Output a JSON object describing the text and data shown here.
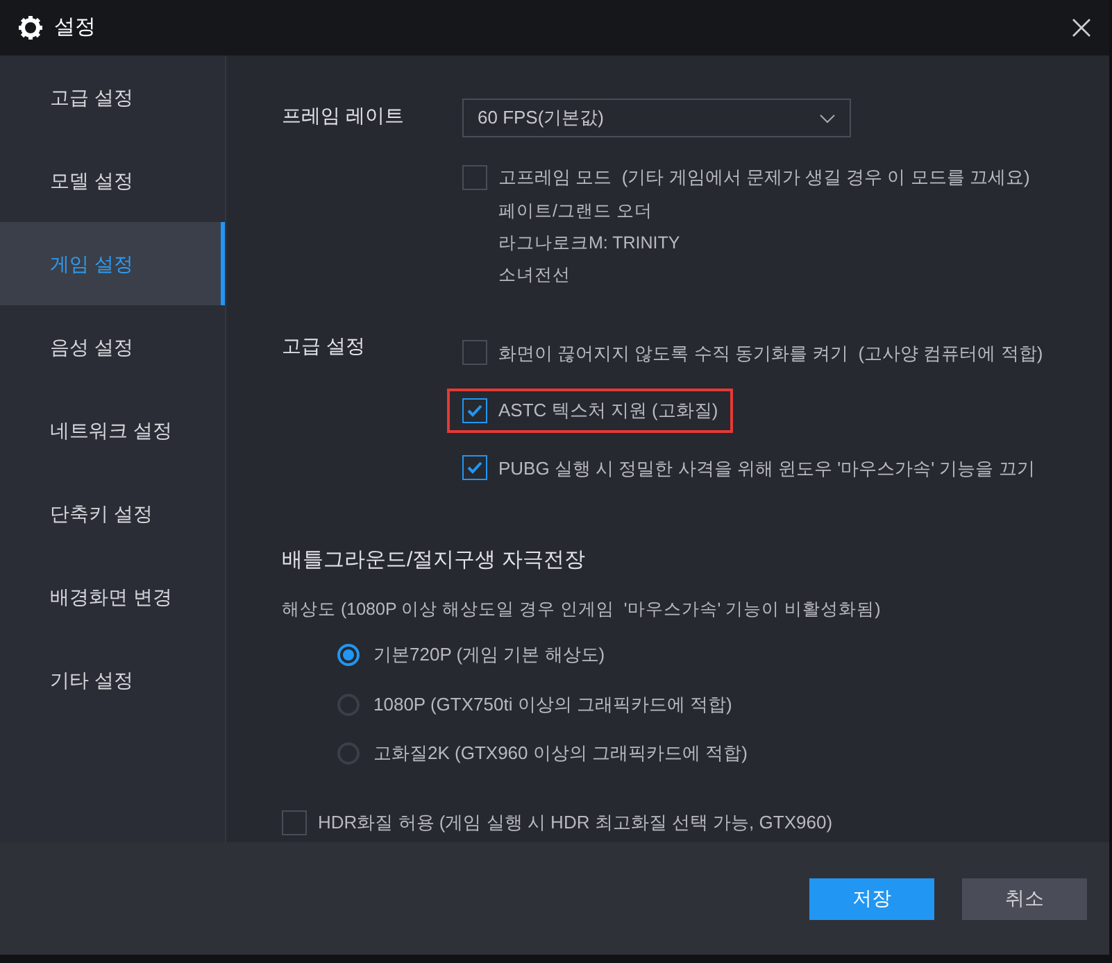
{
  "window": {
    "title": "설정"
  },
  "sidebar": {
    "items": [
      {
        "label": "고급 설정",
        "selected": false
      },
      {
        "label": "모델 설정",
        "selected": false
      },
      {
        "label": "게임 설정",
        "selected": true
      },
      {
        "label": "음성 설정",
        "selected": false
      },
      {
        "label": "네트워크 설정",
        "selected": false
      },
      {
        "label": "단축키 설정",
        "selected": false
      },
      {
        "label": "배경화면 변경",
        "selected": false
      },
      {
        "label": "기타 설정",
        "selected": false
      }
    ]
  },
  "frame_rate": {
    "label": "프레임 레이트",
    "dropdown": "60 FPS(기본값)",
    "high_frame_mode": {
      "label": "고프레임 모드  (기타 게임에서 문제가 생길 경우 이 모드를 끄세요)",
      "checked": false
    },
    "games": [
      "페이트/그랜드 오더",
      "라그나로크M: TRINITY",
      "소녀전선"
    ]
  },
  "advanced": {
    "label": "고급 설정",
    "options": [
      {
        "label": "화면이 끊어지지 않도록 수직 동기화를 켜기  (고사양 컴퓨터에 적합)",
        "checked": false,
        "highlighted": false
      },
      {
        "label": "ASTC 텍스처 지원 (고화질)",
        "checked": true,
        "highlighted": true
      },
      {
        "label": "PUBG 실행 시 정밀한 사격을 위해 윈도우 '마우스가속' 기능을 끄기",
        "checked": true,
        "highlighted": false
      }
    ]
  },
  "battleground": {
    "title": "배틀그라운드/절지구생 자극전장",
    "note": "해상도 (1080P 이상 해상도일 경우 인게임  '마우스가속' 기능이 비활성화됨)",
    "resolutions": [
      {
        "label": "기본720P (게임 기본 해상도)",
        "selected": true
      },
      {
        "label": "1080P (GTX750ti 이상의 그래픽카드에 적합)",
        "selected": false
      },
      {
        "label": "고화질2K (GTX960 이상의 그래픽카드에 적합)",
        "selected": false
      }
    ],
    "hdr": {
      "label": "HDR화질 허용 (게임 실행 시 HDR 최고화질 선택 가능, GTX960)",
      "checked": false
    }
  },
  "buttons": {
    "save": "저장",
    "cancel": "취소"
  }
}
